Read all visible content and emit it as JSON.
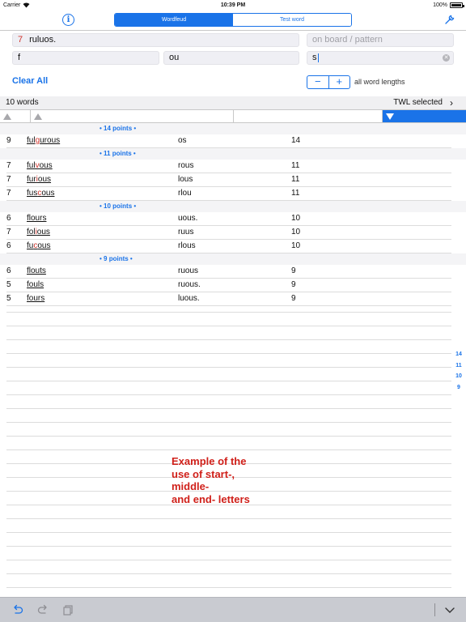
{
  "status_bar": {
    "carrier": "Carrier",
    "time": "10:39 PM",
    "battery": "100%"
  },
  "tabs": [
    {
      "label": "Wordfeud",
      "active": true
    },
    {
      "label": "Test word",
      "active": false
    }
  ],
  "inputs": {
    "letters": {
      "count": "7",
      "value": "ruluos."
    },
    "board_pattern": {
      "placeholder": "on board / pattern"
    },
    "start": {
      "value": "f"
    },
    "middle": {
      "value": "ou"
    },
    "end": {
      "value": "s"
    }
  },
  "controls": {
    "clear_all": "Clear All",
    "minus": "−",
    "plus": "+",
    "word_lengths": "all word lengths"
  },
  "results": {
    "count_label": "10 words",
    "dictionary_label": "TWL selected",
    "groups": [
      {
        "header": "• 14 points •",
        "rows": [
          {
            "len": "9",
            "word_pre": "ful",
            "word_red": "g",
            "word_mid": "ur",
            "word_red2": "",
            "word_post": "ous",
            "rest": "os",
            "points": "14"
          }
        ]
      },
      {
        "header": "• 11 points •",
        "rows": [
          {
            "len": "7",
            "word_pre": "ful",
            "word_red": "v",
            "word_mid": "",
            "word_red2": "",
            "word_post": "ous",
            "rest": "rous",
            "points": "11"
          },
          {
            "len": "7",
            "word_pre": "fur",
            "word_red": "i",
            "word_mid": "",
            "word_red2": "",
            "word_post": "ous",
            "rest": "lous",
            "points": "11"
          },
          {
            "len": "7",
            "word_pre": "fus",
            "word_red": "c",
            "word_mid": "",
            "word_red2": "",
            "word_post": "ous",
            "rest": "rlou",
            "points": "11"
          }
        ]
      },
      {
        "header": "• 10 points •",
        "rows": [
          {
            "len": "6",
            "word_pre": "flours",
            "word_red": "",
            "word_mid": "",
            "word_red2": "",
            "word_post": "",
            "rest": "uous.",
            "points": "10"
          },
          {
            "len": "7",
            "word_pre": "fol",
            "word_red": "i",
            "word_mid": "",
            "word_red2": "",
            "word_post": "ous",
            "rest": "ruus",
            "points": "10"
          },
          {
            "len": "6",
            "word_pre": "fu",
            "word_red": "c",
            "word_mid": "",
            "word_red2": "",
            "word_post": "ous",
            "rest": "rlous",
            "points": "10"
          }
        ]
      },
      {
        "header": "• 9 points •",
        "rows": [
          {
            "len": "6",
            "word_pre": "flouts",
            "word_red": "",
            "word_mid": "",
            "word_red2": "",
            "word_post": "",
            "rest": "ruous",
            "points": "9"
          },
          {
            "len": "5",
            "word_pre": "fouls",
            "word_red": "",
            "word_mid": "",
            "word_red2": "",
            "word_post": "",
            "rest": "ruous.",
            "points": "9"
          },
          {
            "len": "5",
            "word_pre": "fours",
            "word_red": "",
            "word_mid": "",
            "word_red2": "",
            "word_post": "",
            "rest": "luous.",
            "points": "9"
          }
        ]
      }
    ]
  },
  "index": [
    "14",
    "11",
    "10",
    "9"
  ],
  "annotation": [
    "Example of the",
    "use of start-,",
    "middle-",
    "and end- letters"
  ],
  "colors": {
    "accent": "#1a73e8",
    "highlight": "#d0342c",
    "annotation": "#d0201a"
  },
  "icons": [
    "info-icon",
    "wrench-icon",
    "undo-icon",
    "redo-icon",
    "copy-icon",
    "chevron-down-icon",
    "chevron-right-icon"
  ]
}
